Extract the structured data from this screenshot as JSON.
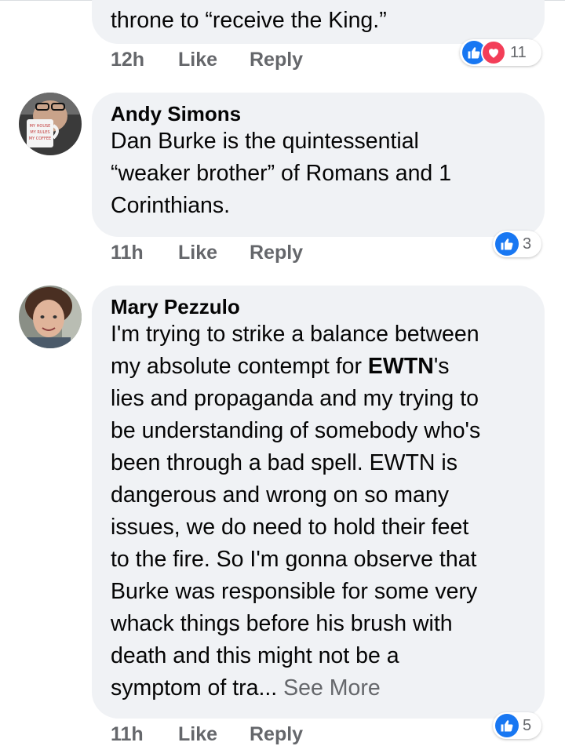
{
  "comments": [
    {
      "author": "",
      "text_tail": "throne to “receive the King.”",
      "time": "12h",
      "like_label": "Like",
      "reply_label": "Reply",
      "reactions": {
        "types": [
          "like-icon",
          "love-icon"
        ],
        "count": "11"
      }
    },
    {
      "author": "Andy Simons",
      "lines": [
        "Dan Burke is the quintessential",
        "“weaker brother” of Romans and 1",
        "Corinthians."
      ],
      "mug_text": "MY HOUSE MY RULES MY COFFEE",
      "time": "11h",
      "like_label": "Like",
      "reply_label": "Reply",
      "reactions": {
        "types": [
          "like-icon"
        ],
        "count": "3"
      }
    },
    {
      "author": "Mary Pezzulo",
      "line1_prefix": "I'm trying to strike a balance between",
      "line2_prefix": "my absolute contempt for ",
      "line2_bold": "EWTN",
      "line2_suffix": "'s",
      "lines_rest": [
        "lies and propaganda and my trying to",
        "be understanding of somebody who's",
        "been through a bad spell. EWTN is",
        "dangerous and wrong on so many",
        "issues, we do need to hold their feet",
        "to the fire. So I'm gonna observe that",
        "Burke was responsible for some very",
        "whack things before his brush with",
        "death and this might not be a"
      ],
      "last_line": "symptom of tra...",
      "see_more": "See More",
      "time": "11h",
      "like_label": "Like",
      "reply_label": "Reply",
      "reactions": {
        "types": [
          "like-icon"
        ],
        "count": "5"
      }
    }
  ],
  "colors": {
    "bubble": "#f0f2f5",
    "meta": "#65676b",
    "like_blue": "#1877f2",
    "love_red": "#f33e58"
  }
}
